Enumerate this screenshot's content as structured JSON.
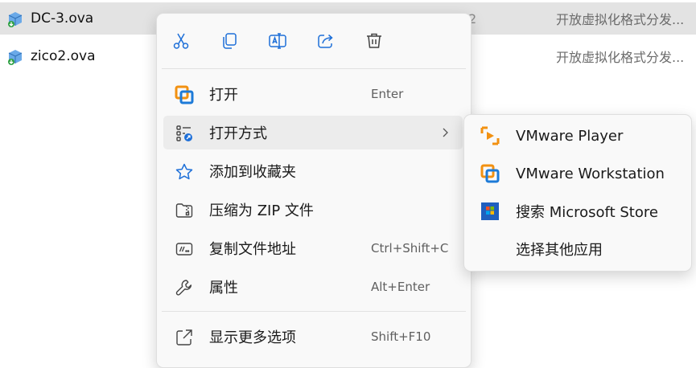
{
  "files": [
    {
      "name": "DC-3.ova",
      "extra": "2",
      "type": "开放虚拟化格式分发...",
      "selected": true
    },
    {
      "name": "zico2.ova",
      "extra": "",
      "type": "开放虚拟化格式分发...",
      "selected": false
    }
  ],
  "context_menu": {
    "quick_actions": [
      {
        "icon": "cut-icon",
        "label": ""
      },
      {
        "icon": "copy-icon",
        "label": ""
      },
      {
        "icon": "rename-icon",
        "label": ""
      },
      {
        "icon": "share-icon",
        "label": ""
      },
      {
        "icon": "delete-icon",
        "label": ""
      }
    ],
    "items": [
      {
        "label": "打开",
        "shortcut": "Enter",
        "icon": "vmware-icon"
      },
      {
        "label": "打开方式",
        "shortcut": "",
        "icon": "open-with-icon",
        "has_submenu": true
      },
      {
        "label": "添加到收藏夹",
        "shortcut": "",
        "icon": "star-icon"
      },
      {
        "label": "压缩为 ZIP 文件",
        "shortcut": "",
        "icon": "zip-folder-icon"
      },
      {
        "label": "复制文件地址",
        "shortcut": "Ctrl+Shift+C",
        "icon": "copy-path-icon"
      },
      {
        "label": "属性",
        "shortcut": "Alt+Enter",
        "icon": "wrench-icon"
      },
      {
        "label": "显示更多选项",
        "shortcut": "Shift+F10",
        "icon": "more-options-icon"
      }
    ]
  },
  "submenu": {
    "items": [
      {
        "label": "VMware Player",
        "icon": "vmware-player-icon"
      },
      {
        "label": "VMware Workstation",
        "icon": "vmware-workstation-icon"
      },
      {
        "label": "搜索 Microsoft Store",
        "icon": "microsoft-store-icon"
      },
      {
        "label": "选择其他应用",
        "icon": ""
      }
    ]
  },
  "colors": {
    "selection": "#e3e3e3",
    "menu_bg": "#f9f9f9",
    "accent_blue": "#1d6fd8",
    "vmware_orange": "#f29111"
  }
}
